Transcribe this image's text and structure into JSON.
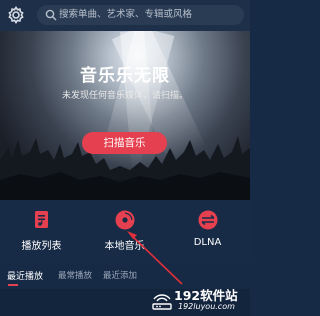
{
  "header": {
    "settings_icon": "gear-icon",
    "search_icon": "search-icon",
    "search_placeholder": "搜索单曲、艺术家、专辑或风格"
  },
  "hero": {
    "title": "音乐乐无限",
    "subtitle": "未发现任何音乐媒体，请扫描。",
    "scan_button": "扫描音乐",
    "accent": "#e5404f"
  },
  "features": [
    {
      "label": "播放列表",
      "icon": "playlist-icon"
    },
    {
      "label": "本地音乐",
      "icon": "disc-icon"
    },
    {
      "label": "DLNA",
      "icon": "dlna-icon"
    }
  ],
  "tabs": [
    {
      "label": "最近播放",
      "active": true
    },
    {
      "label": "最常播放",
      "active": false
    },
    {
      "label": "最近添加",
      "active": false
    }
  ],
  "watermark": {
    "brand": "192软件站",
    "url": "192luyou.com"
  }
}
